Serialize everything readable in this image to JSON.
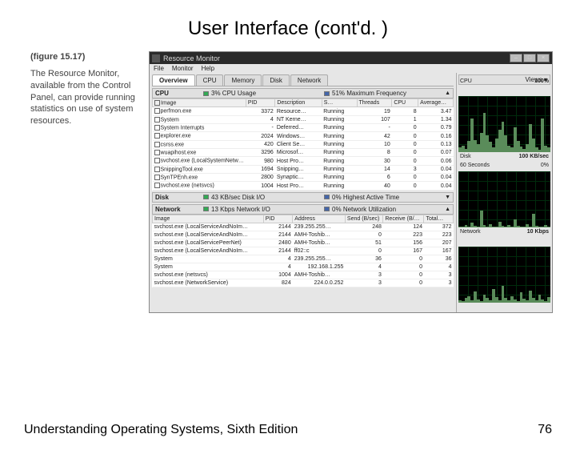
{
  "slide": {
    "title": "User Interface (cont'd. )",
    "footer_left": "Understanding Operating Systems, Sixth Edition",
    "footer_right": "76"
  },
  "caption": {
    "figure": "(figure 15.17)",
    "text": "The Resource Monitor, available from the Control Panel, can provide running statistics on use of system resources."
  },
  "window": {
    "title": "Resource Monitor",
    "menus": [
      "File",
      "Monitor",
      "Help"
    ],
    "tabs": [
      "Overview",
      "CPU",
      "Memory",
      "Disk",
      "Network"
    ],
    "active_tab": "Overview",
    "views_label": "Views"
  },
  "cpu_section": {
    "label": "CPU",
    "metric1": "3% CPU Usage",
    "metric2": "51% Maximum Frequency",
    "headers": [
      "Image",
      "PID",
      "Description",
      "S…",
      "Threads",
      "CPU",
      "Average…"
    ],
    "rows": [
      [
        "perfmon.exe",
        "3372",
        "Resource…",
        "Running",
        "19",
        "8",
        "3.47"
      ],
      [
        "System",
        "4",
        "NT Kerne…",
        "Running",
        "107",
        "1",
        "1.34"
      ],
      [
        "System Interrupts",
        "-",
        "Deferred…",
        "Running",
        "-",
        "0",
        "0.79"
      ],
      [
        "explorer.exe",
        "2024",
        "Windows…",
        "Running",
        "42",
        "0",
        "0.16"
      ],
      [
        "csrss.exe",
        "420",
        "Client Se…",
        "Running",
        "10",
        "0",
        "0.13"
      ],
      [
        "wuapihost.exe",
        "3296",
        "Microsof…",
        "Running",
        "8",
        "0",
        "0.07"
      ],
      [
        "svchost.exe (LocalSystemNetwo…",
        "980",
        "Host Pro…",
        "Running",
        "30",
        "0",
        "0.06"
      ],
      [
        "SnippingTool.exe",
        "1694",
        "Snipping…",
        "Running",
        "14",
        "3",
        "0.04"
      ],
      [
        "SynTPEnh.exe",
        "2800",
        "Synaptic…",
        "Running",
        "6",
        "0",
        "0.04"
      ],
      [
        "svchost.exe (netsvcs)",
        "1004",
        "Host Pro…",
        "Running",
        "40",
        "0",
        "0.04"
      ]
    ]
  },
  "disk_section": {
    "label": "Disk",
    "metric1": "43 KB/sec Disk I/O",
    "metric2": "0% Highest Active Time"
  },
  "net_section": {
    "label": "Network",
    "metric1": "13 Kbps Network I/O",
    "metric2": "0% Network Utilization",
    "headers": [
      "Image",
      "PID",
      "Address",
      "Send (B/sec)",
      "Receive (B/…",
      "Total…"
    ],
    "rows": [
      [
        "svchost.exe (LocalServiceAndNoIm…",
        "2144",
        "239.255.255…",
        "248",
        "124",
        "372"
      ],
      [
        "svchost.exe (LocalServiceAndNoIm…",
        "2144",
        "AMH-Toshib…",
        "0",
        "223",
        "223"
      ],
      [
        "svchost.exe (LocalServicePeerNet)",
        "2480",
        "AMH-Toshib…",
        "51",
        "156",
        "207"
      ],
      [
        "svchost.exe (LocalServiceAndNoIm…",
        "2144",
        "ff02::c",
        "0",
        "167",
        "167"
      ],
      [
        "System",
        "4",
        "239.255.255…",
        "36",
        "0",
        "36"
      ],
      [
        "System",
        "4",
        "192.168.1.255",
        "4",
        "0",
        "4"
      ],
      [
        "svchost.exe (netsvcs)",
        "1004",
        "AMH-Toshib…",
        "3",
        "0",
        "3"
      ],
      [
        "svchost.exe (NetworkService)",
        "824",
        "224.0.0.252",
        "3",
        "0",
        "3"
      ]
    ]
  },
  "charts": {
    "cpu": {
      "label": "CPU",
      "val": "100%",
      "lower_l": "60 Seconds",
      "lower_r": "0%"
    },
    "disk": {
      "label": "Disk",
      "val": "100 KB/sec"
    },
    "network": {
      "label": "Network",
      "val": "10 Kbps"
    }
  }
}
